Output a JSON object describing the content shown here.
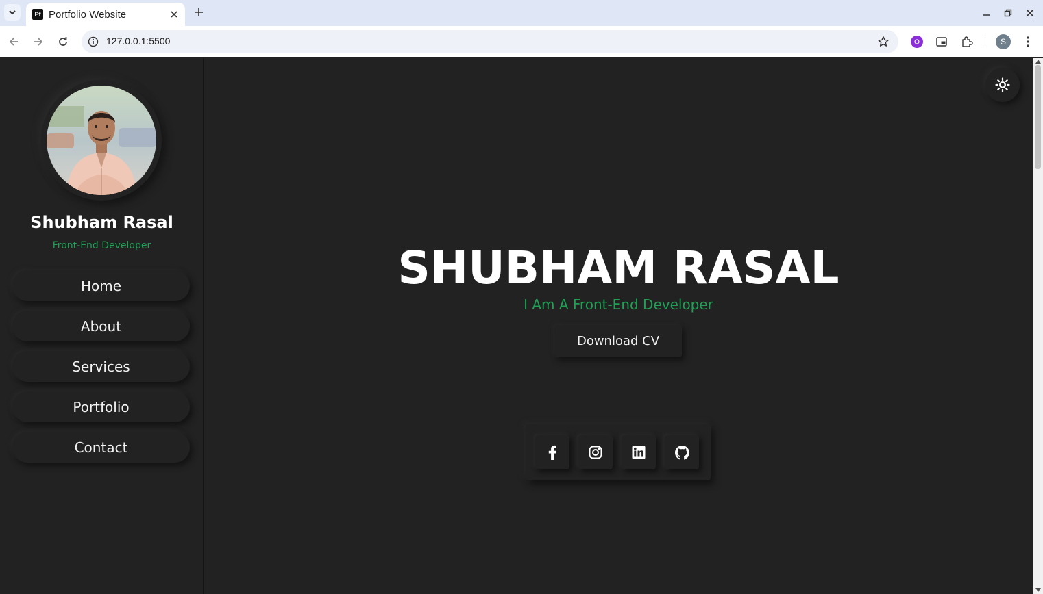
{
  "browser": {
    "tab_title": "Portfolio Website",
    "favicon_text": "Pf",
    "url": "127.0.0.1:5500",
    "profile_initial": "S"
  },
  "sidebar": {
    "name": "Shubham Rasal",
    "role": "Front-End Developer",
    "nav": [
      {
        "label": "Home"
      },
      {
        "label": "About"
      },
      {
        "label": "Services"
      },
      {
        "label": "Portfolio"
      },
      {
        "label": "Contact"
      }
    ]
  },
  "hero": {
    "title": "SHUBHAM RASAL",
    "subtitle": "I Am A Front-End Developer",
    "cv_button": "Download CV"
  },
  "social": [
    "facebook-icon",
    "instagram-icon",
    "linkedin-icon",
    "github-icon"
  ],
  "colors": {
    "accent": "#1fa055",
    "background": "#222222",
    "text": "#ffffff"
  }
}
